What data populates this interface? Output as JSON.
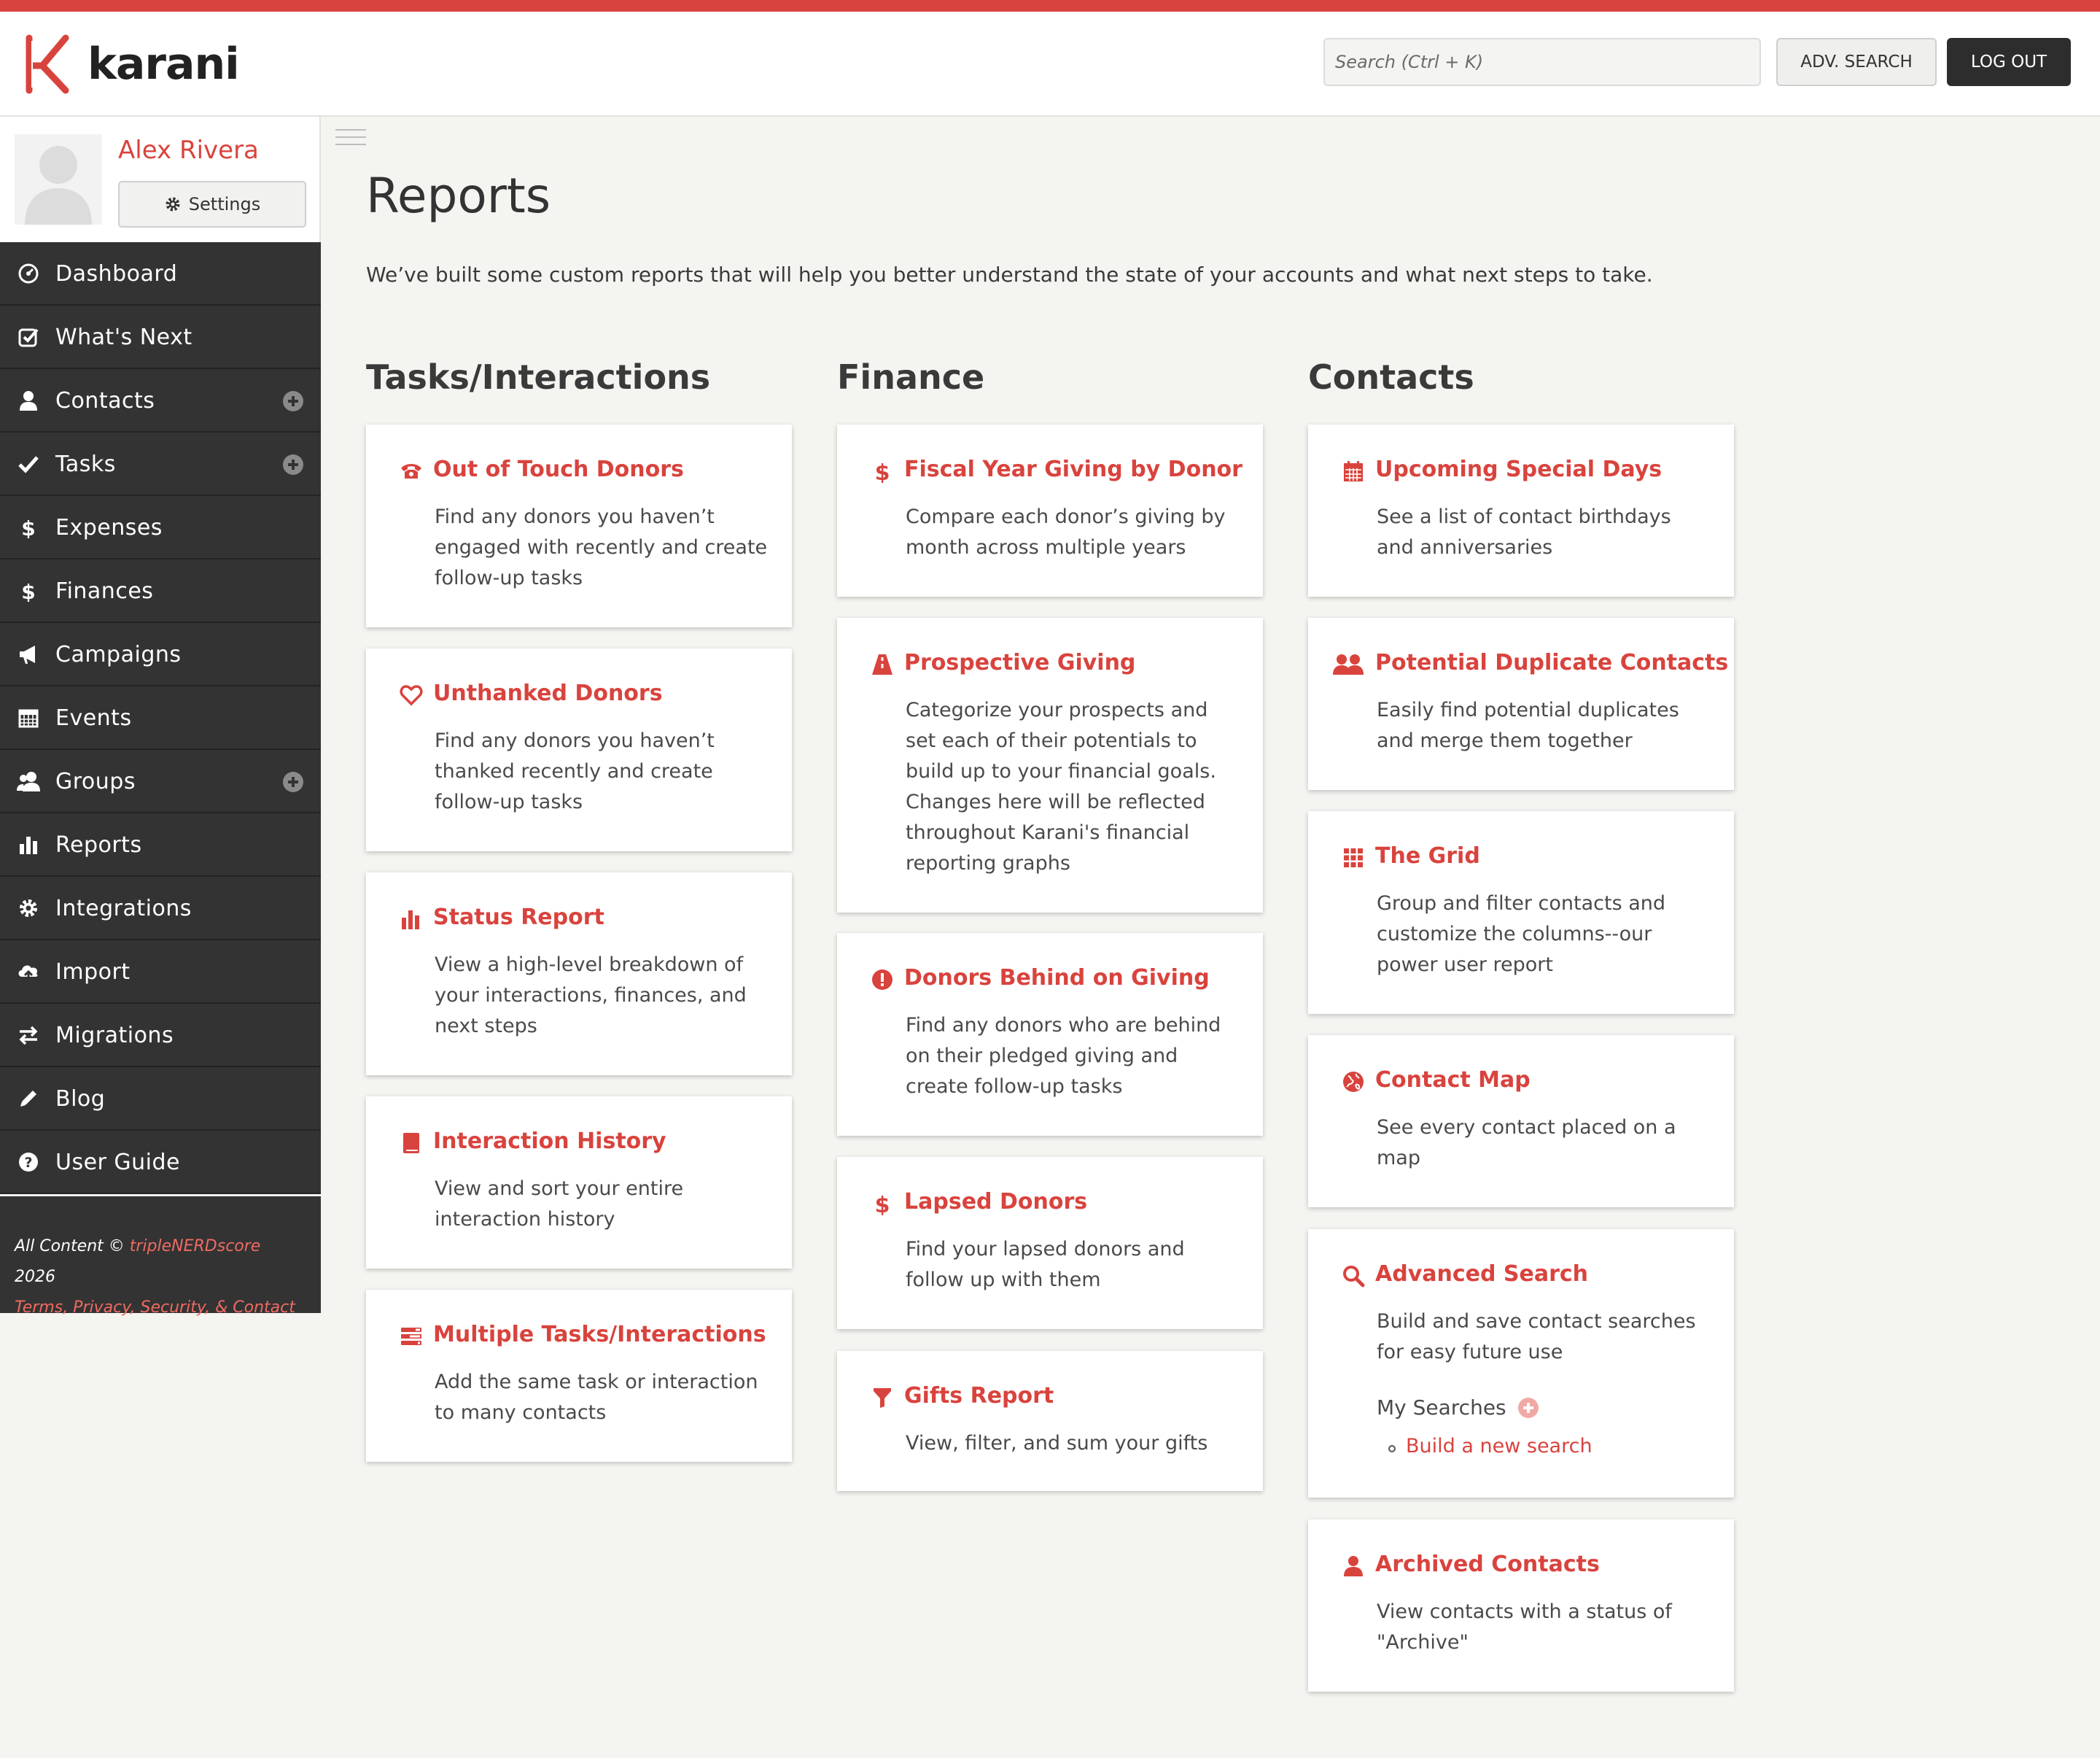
{
  "app": {
    "name": "karani",
    "accent": "#d9433d",
    "dark": "#333333"
  },
  "header": {
    "search_placeholder": "Search (Ctrl + K)",
    "adv_search_label": "ADV. SEARCH",
    "logout_label": "LOG OUT"
  },
  "profile": {
    "name": "Alex Rivera",
    "settings_label": "Settings"
  },
  "sidebar": {
    "items": [
      {
        "label": "Dashboard",
        "icon": "dashboard-icon",
        "has_add": false
      },
      {
        "label": "What's Next",
        "icon": "check-square-icon",
        "has_add": false
      },
      {
        "label": "Contacts",
        "icon": "user-icon",
        "has_add": true
      },
      {
        "label": "Tasks",
        "icon": "check-icon",
        "has_add": true
      },
      {
        "label": "Expenses",
        "icon": "dollar-icon",
        "has_add": false
      },
      {
        "label": "Finances",
        "icon": "dollar-icon",
        "has_add": false
      },
      {
        "label": "Campaigns",
        "icon": "bullhorn-icon",
        "has_add": false
      },
      {
        "label": "Events",
        "icon": "calendar-icon",
        "has_add": false
      },
      {
        "label": "Groups",
        "icon": "users-icon",
        "has_add": true
      },
      {
        "label": "Reports",
        "icon": "bar-chart-icon",
        "has_add": false
      },
      {
        "label": "Integrations",
        "icon": "gear-icon",
        "has_add": false
      },
      {
        "label": "Import",
        "icon": "cloud-upload-icon",
        "has_add": false
      },
      {
        "label": "Migrations",
        "icon": "exchange-icon",
        "has_add": false
      },
      {
        "label": "Blog",
        "icon": "pencil-icon",
        "has_add": false
      },
      {
        "label": "User Guide",
        "icon": "question-circle-icon",
        "has_add": false
      }
    ],
    "footer": {
      "all_content": "All Content ©",
      "company": "tripleNERDscore",
      "year": "2026",
      "links": "Terms, Privacy, Security, & Contact"
    }
  },
  "main": {
    "title": "Reports",
    "intro": "We’ve built some custom reports that will help you better understand the state of your accounts and what next steps to take.",
    "columns": [
      {
        "heading": "Tasks/Interactions",
        "cards": [
          {
            "title": "Out of Touch Donors",
            "icon": "phone-icon",
            "desc": "Find any donors you haven’t engaged with recently and create follow-up tasks"
          },
          {
            "title": "Unthanked Donors",
            "icon": "heart-icon",
            "desc": "Find any donors you haven’t thanked recently and create follow-up tasks"
          },
          {
            "title": "Status Report",
            "icon": "bar-chart-icon",
            "desc": "View a high-level breakdown of your interactions, finances, and next steps"
          },
          {
            "title": "Interaction History",
            "icon": "book-icon",
            "desc": "View and sort your entire interaction history"
          },
          {
            "title": "Multiple Tasks/Interactions",
            "icon": "tasks-icon",
            "desc": "Add the same task or interaction to many contacts"
          }
        ]
      },
      {
        "heading": "Finance",
        "cards": [
          {
            "title": "Fiscal Year Giving by Donor",
            "icon": "dollar-icon",
            "desc": "Compare each donor’s giving by month across multiple years"
          },
          {
            "title": "Prospective Giving",
            "icon": "road-icon",
            "desc": "Categorize your prospects and set each of their potentials to build up to your financial goals. Changes here will be reflected throughout Karani's financial reporting graphs"
          },
          {
            "title": "Donors Behind on Giving",
            "icon": "exclamation-circle-icon",
            "desc": "Find any donors who are behind on their pledged giving and create follow-up tasks"
          },
          {
            "title": "Lapsed Donors",
            "icon": "dollar-icon",
            "desc": "Find your lapsed donors and follow up with them"
          },
          {
            "title": "Gifts Report",
            "icon": "filter-icon",
            "desc": "View, filter, and sum your gifts"
          }
        ]
      },
      {
        "heading": "Contacts",
        "cards": [
          {
            "title": "Upcoming Special Days",
            "icon": "calendar-icon",
            "desc": "See a list of contact birthdays and anniversaries"
          },
          {
            "title": "Potential Duplicate Contacts",
            "icon": "users-icon",
            "desc": "Easily find potential duplicates and merge them together"
          },
          {
            "title": "The Grid",
            "icon": "grid-icon",
            "desc": "Group and filter contacts and customize the columns--our power user report"
          },
          {
            "title": "Contact Map",
            "icon": "globe-icon",
            "desc": "See every contact placed on a map"
          },
          {
            "title": "Advanced Search",
            "icon": "search-icon",
            "desc": "Build and save contact searches for easy future use",
            "my_searches": "My Searches",
            "build_link": "Build a new search"
          },
          {
            "title": "Archived Contacts",
            "icon": "user-icon",
            "desc": "View contacts with a status of \"Archive\""
          }
        ]
      }
    ]
  }
}
